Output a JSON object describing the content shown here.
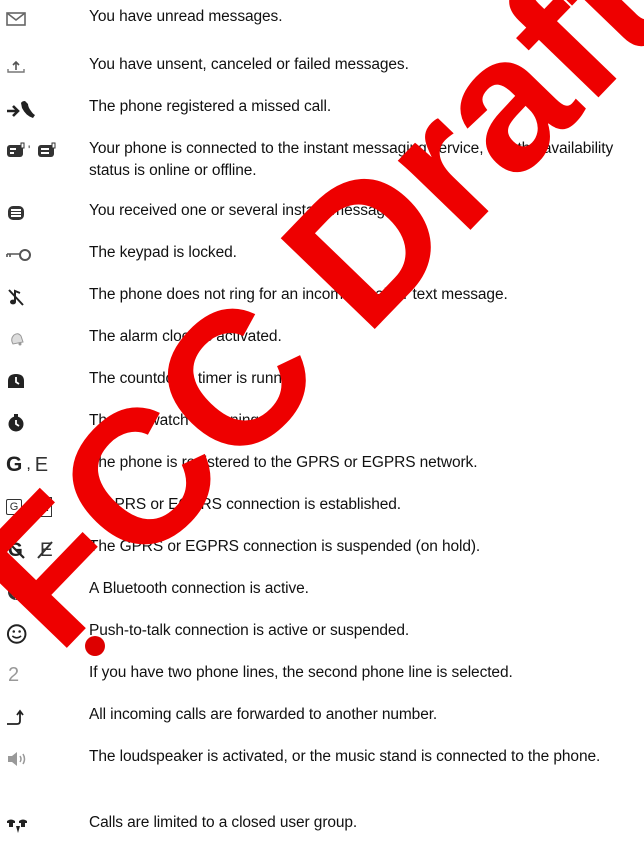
{
  "rows": [
    {
      "icon": "envelope-icon",
      "text": "You have unread messages."
    },
    {
      "icon": "outbox-icon",
      "text": "You have unsent, canceled or failed messages."
    },
    {
      "icon": "missed-call-icon",
      "text": "The phone registered a missed call."
    },
    {
      "icon": "instant-messaging-status-icon",
      "text": "Your phone is connected to the instant messaging service, and the availability status is online or offline."
    },
    {
      "icon": "instant-message-icon",
      "text": "You received one or several instant messages."
    },
    {
      "icon": "key-icon",
      "text": "The keypad is locked."
    },
    {
      "icon": "silent-icon",
      "text": "The phone does not ring for an incoming call or text message."
    },
    {
      "icon": "alarm-bell-icon",
      "text": "The alarm clock is activated."
    },
    {
      "icon": "countdown-timer-icon",
      "text": "The countdown timer is running."
    },
    {
      "icon": "stopwatch-icon",
      "text": "The stopwatch is running."
    },
    {
      "icon": "gprs-egprs-registered-icon",
      "text": "The phone is registered to the GPRS or EGPRS network."
    },
    {
      "icon": "gprs-egprs-connected-icon",
      "text": "A GPRS or EGPRS connection is established."
    },
    {
      "icon": "gprs-egprs-suspended-icon",
      "text": "The GPRS or EGPRS connection is suspended (on hold)."
    },
    {
      "icon": "bluetooth-icon",
      "text": "A Bluetooth connection is active."
    },
    {
      "icon": "push-to-talk-icon",
      "text": "Push-to-talk connection is active or suspended."
    },
    {
      "icon": "second-line-icon",
      "text": "If you have two phone lines, the second phone line is selected."
    },
    {
      "icon": "call-forward-icon",
      "text": "All incoming calls are forwarded to another number."
    },
    {
      "icon": "loudspeaker-icon",
      "text": "The loudspeaker is activated, or the music stand is connected to the phone."
    },
    {
      "icon": "closed-user-group-icon",
      "text": "Calls are limited to a closed user group."
    }
  ],
  "icon_glyphs": {
    "gprs_letters": [
      "G",
      "E"
    ],
    "separator": ",",
    "second_line": "2"
  },
  "watermark": {
    "text": "FCC Draft",
    "color": "#ee0000"
  }
}
